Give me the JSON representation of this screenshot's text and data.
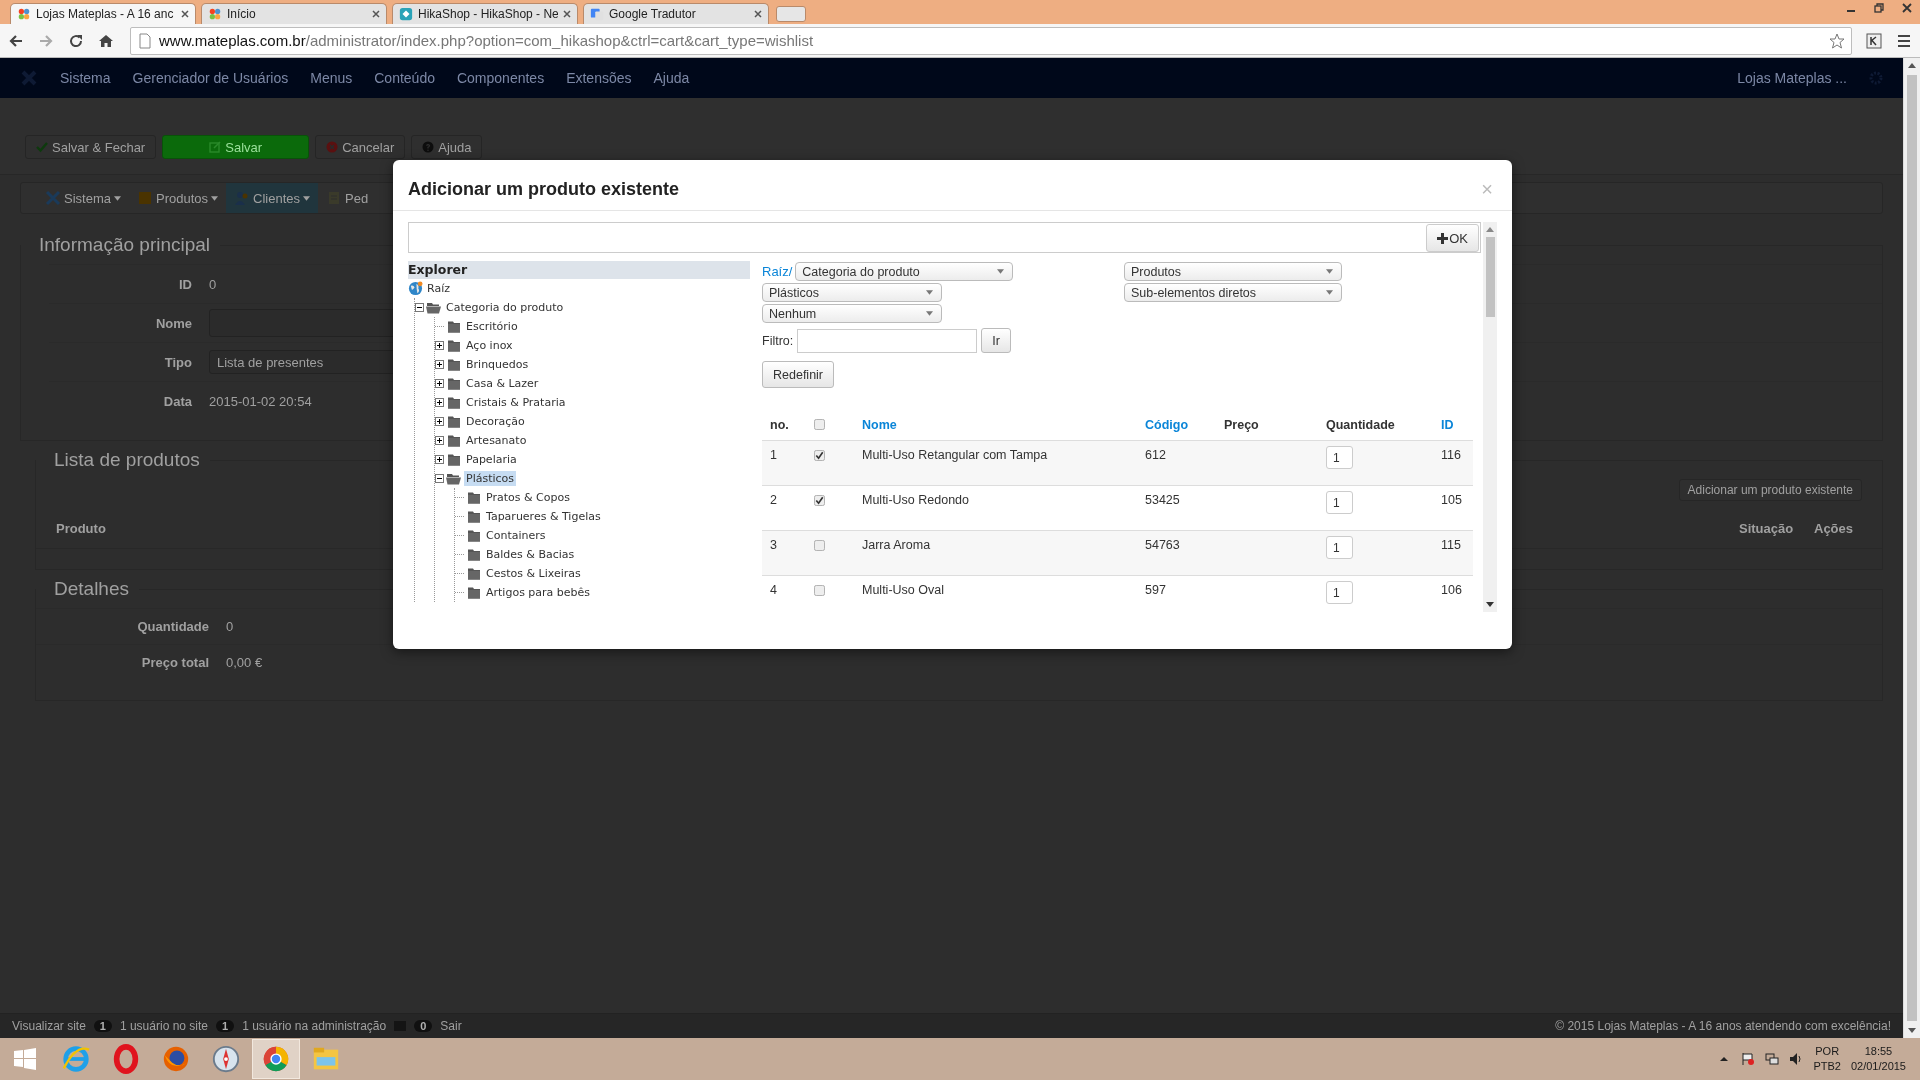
{
  "browser": {
    "tabs": [
      {
        "title": "Lojas Mateplas - A 16 anc",
        "kind": "joomla",
        "selected": true
      },
      {
        "title": "Início",
        "kind": "joomla",
        "selected": false
      },
      {
        "title": "HikaShop - HikaShop - Ne",
        "kind": "hikashop",
        "selected": false
      },
      {
        "title": "Google Tradutor",
        "kind": "translate",
        "selected": false
      }
    ],
    "url_host": "www.mateplas.com.br",
    "url_path": "/administrator/index.php?option=com_hikashop&ctrl=cart&cart_type=wishlist"
  },
  "admin_menu": {
    "items": [
      "Sistema",
      "Gerenciador de Usuários",
      "Menus",
      "Conteúdo",
      "Componentes",
      "Extensões",
      "Ajuda"
    ],
    "site_link": "Lojas Mateplas ..."
  },
  "toolbar": [
    {
      "label": "Salvar & Fechar",
      "kind": "save-close"
    },
    {
      "label": "Salvar",
      "kind": "save"
    },
    {
      "label": "Cancelar",
      "kind": "cancel"
    },
    {
      "label": "Ajuda",
      "kind": "help"
    }
  ],
  "submenu": [
    {
      "label": "Sistema",
      "kind": "system",
      "selected": false
    },
    {
      "label": "Produtos",
      "kind": "products",
      "selected": false
    },
    {
      "label": "Clientes",
      "kind": "customers",
      "selected": true
    },
    {
      "label": "Ped",
      "kind": "orders",
      "selected": false
    }
  ],
  "main_info": {
    "legend": "Informação principal",
    "fields": [
      {
        "label": "ID",
        "kind": "text",
        "value": "0"
      },
      {
        "label": "Nome",
        "kind": "input"
      },
      {
        "label": "Tipo",
        "kind": "select",
        "value": "Lista de presentes"
      },
      {
        "label": "Data",
        "kind": "text",
        "value": "2015-01-02 20:54"
      }
    ]
  },
  "products_list": {
    "legend": "Lista de produtos",
    "add_button": "Adicionar um produto existente",
    "columns": [
      "Produto",
      "Situação",
      "Ações"
    ]
  },
  "details": {
    "legend": "Detalhes",
    "fields": [
      {
        "label": "Quantidade",
        "value": "0"
      },
      {
        "label": "Preço total",
        "value": "0,00 €"
      }
    ]
  },
  "status_bar": {
    "view_site": "Visualizar site",
    "counters": [
      {
        "kind": "users",
        "count": "1",
        "label": "1 usuário no site"
      },
      {
        "kind": "users",
        "count": "1",
        "label": "1 usuário na administração"
      },
      {
        "kind": "mail",
        "count": "0"
      }
    ],
    "logout": "Sair",
    "copyright": "© 2015 Lojas Mateplas - A 16 anos atendendo com excelência!"
  },
  "modal": {
    "title": "Adicionar um produto existente",
    "close": "×",
    "ok_button": "OK",
    "explorer_title": "Explorer",
    "tree": [
      {
        "label": "Raíz",
        "kind": "root",
        "expanded": true,
        "selected": false,
        "children": [
          {
            "label": "Categoria do produto",
            "kind": "branch",
            "expanded": true,
            "selected": false,
            "children": [
              {
                "label": "Escritório",
                "kind": "leaf",
                "expanded": false,
                "selected": false
              },
              {
                "label": "Aço inox",
                "kind": "branch",
                "expanded": false,
                "selected": false
              },
              {
                "label": "Brinquedos",
                "kind": "branch",
                "expanded": false,
                "selected": false
              },
              {
                "label": "Casa & Lazer",
                "kind": "branch",
                "expanded": false,
                "selected": false
              },
              {
                "label": "Cristais & Prataria",
                "kind": "branch",
                "expanded": false,
                "selected": false
              },
              {
                "label": "Decoração",
                "kind": "branch",
                "expanded": false,
                "selected": false
              },
              {
                "label": "Artesanato",
                "kind": "branch",
                "expanded": false,
                "selected": false
              },
              {
                "label": "Papelaria",
                "kind": "branch",
                "expanded": false,
                "selected": false
              },
              {
                "label": "Plásticos",
                "kind": "branch",
                "expanded": true,
                "selected": true,
                "children": [
                  {
                    "label": "Pratos & Copos",
                    "kind": "leaf",
                    "expanded": false,
                    "selected": false
                  },
                  {
                    "label": "Taparueres & Tigelas",
                    "kind": "leaf",
                    "expanded": false,
                    "selected": false
                  },
                  {
                    "label": "Containers",
                    "kind": "leaf",
                    "expanded": false,
                    "selected": false
                  },
                  {
                    "label": "Baldes & Bacias",
                    "kind": "leaf",
                    "expanded": false,
                    "selected": false
                  },
                  {
                    "label": "Cestos & Lixeiras",
                    "kind": "leaf",
                    "expanded": false,
                    "selected": false
                  },
                  {
                    "label": "Artigos para bebês",
                    "kind": "leaf",
                    "expanded": false,
                    "selected": false
                  }
                ]
              }
            ]
          }
        ]
      }
    ],
    "breadcrumb": "Raíz/",
    "selects_left": [
      "Categoria do produto",
      "Plásticos",
      "Nenhum"
    ],
    "selects_right": [
      "Produtos",
      "Sub-elementos diretos"
    ],
    "filter_label": "Filtro:",
    "filter_button": "Ir",
    "reset_button": "Redefinir",
    "table": {
      "select_all_checked": false,
      "columns": [
        {
          "label": "no.",
          "sortable": false
        },
        {
          "label": "Nome",
          "sortable": true
        },
        {
          "label": "Código",
          "sortable": true
        },
        {
          "label": "Preço",
          "sortable": false
        },
        {
          "label": "Quantidade",
          "sortable": false
        },
        {
          "label": "ID",
          "sortable": true
        }
      ],
      "rows": [
        {
          "no": "1",
          "checked": true,
          "name": "Multi-Uso Retangular com Tampa",
          "code": "612",
          "quantity": "1",
          "id": "116"
        },
        {
          "no": "2",
          "checked": true,
          "name": "Multi-Uso Redondo",
          "code": "53425",
          "quantity": "1",
          "id": "105"
        },
        {
          "no": "3",
          "checked": false,
          "name": "Jarra Aroma",
          "code": "54763",
          "quantity": "1",
          "id": "115"
        },
        {
          "no": "4",
          "checked": false,
          "name": "Multi-Uso Oval",
          "code": "597",
          "quantity": "1",
          "id": "106"
        }
      ]
    }
  },
  "taskbar": {
    "apps": [
      {
        "kind": "ie",
        "selected": false
      },
      {
        "kind": "opera",
        "selected": false
      },
      {
        "kind": "firefox",
        "selected": false
      },
      {
        "kind": "safari",
        "selected": false
      },
      {
        "kind": "chrome",
        "selected": true
      },
      {
        "kind": "files",
        "selected": false
      }
    ],
    "language": "POR",
    "layout": "PTB2",
    "time": "18:55",
    "date": "02/01/2015"
  }
}
